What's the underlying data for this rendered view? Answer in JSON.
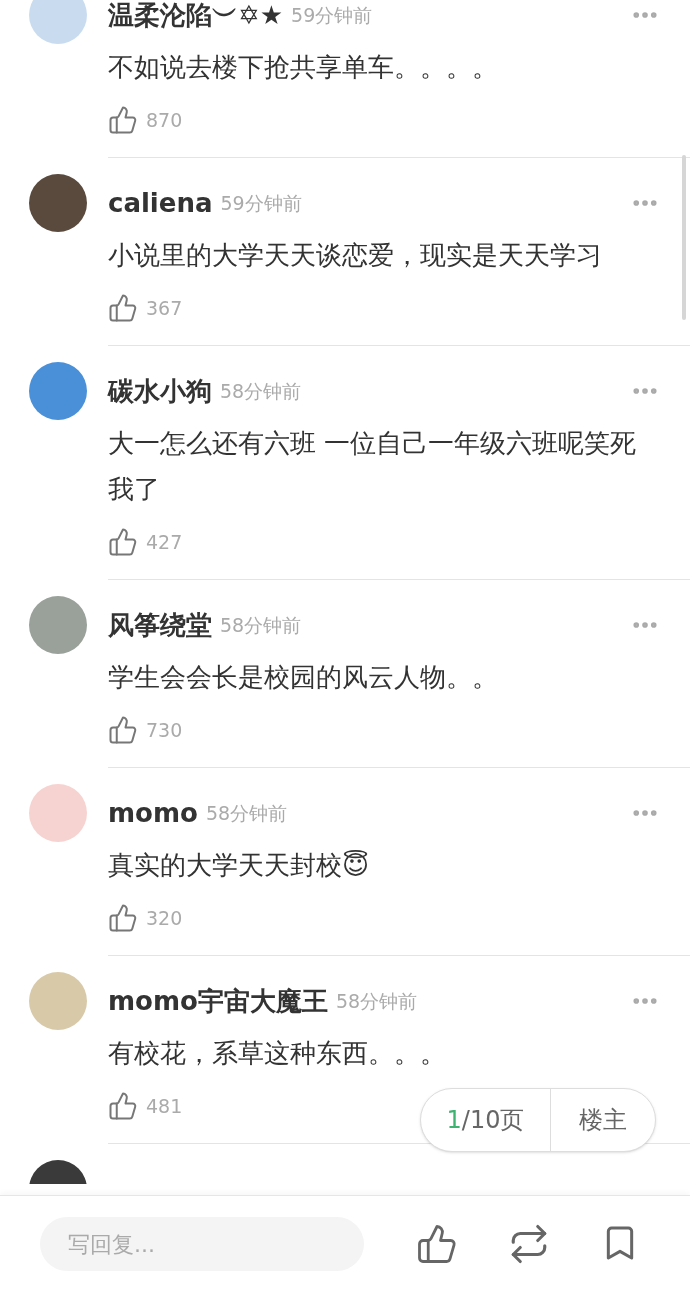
{
  "comments": [
    {
      "kind": "comment",
      "name": "温柔沦陷︶✡★",
      "time": "59分钟前",
      "text": "不如说去楼下抢共享单车。。。。",
      "likes": "870",
      "color": "#c9dcef"
    },
    {
      "kind": "comment",
      "name": "caliena",
      "time": "59分钟前",
      "text": "小说里的大学天天谈恋爱，现实是天天学习",
      "likes": "367",
      "color": "#5a4a3e"
    },
    {
      "kind": "comment",
      "name": "碳水小狗",
      "time": "58分钟前",
      "text": "大一怎么还有六班 一位自己一年级六班呢笑死我了",
      "likes": "427",
      "color": "#4a90d9"
    },
    {
      "kind": "comment",
      "name": "风筝绕堂",
      "time": "58分钟前",
      "text": "学生会会长是校园的风云人物。。",
      "likes": "730",
      "color": "#9aa09a"
    },
    {
      "kind": "comment",
      "name": "momo",
      "time": "58分钟前",
      "text": "真实的大学天天封校😇",
      "likes": "320",
      "color": "#f6d3d0"
    },
    {
      "kind": "comment",
      "name": "momo宇宙大魔王",
      "time": "58分钟前",
      "text": "有校花，系草这种东西。。。",
      "likes": "481",
      "color": "#d8c9a8"
    },
    {
      "kind": "partial",
      "color": "#3a3a3a"
    }
  ],
  "pager": {
    "current": "1",
    "total": "/10页",
    "owner_button": "楼主"
  },
  "reply_bar": {
    "placeholder": "写回复..."
  }
}
